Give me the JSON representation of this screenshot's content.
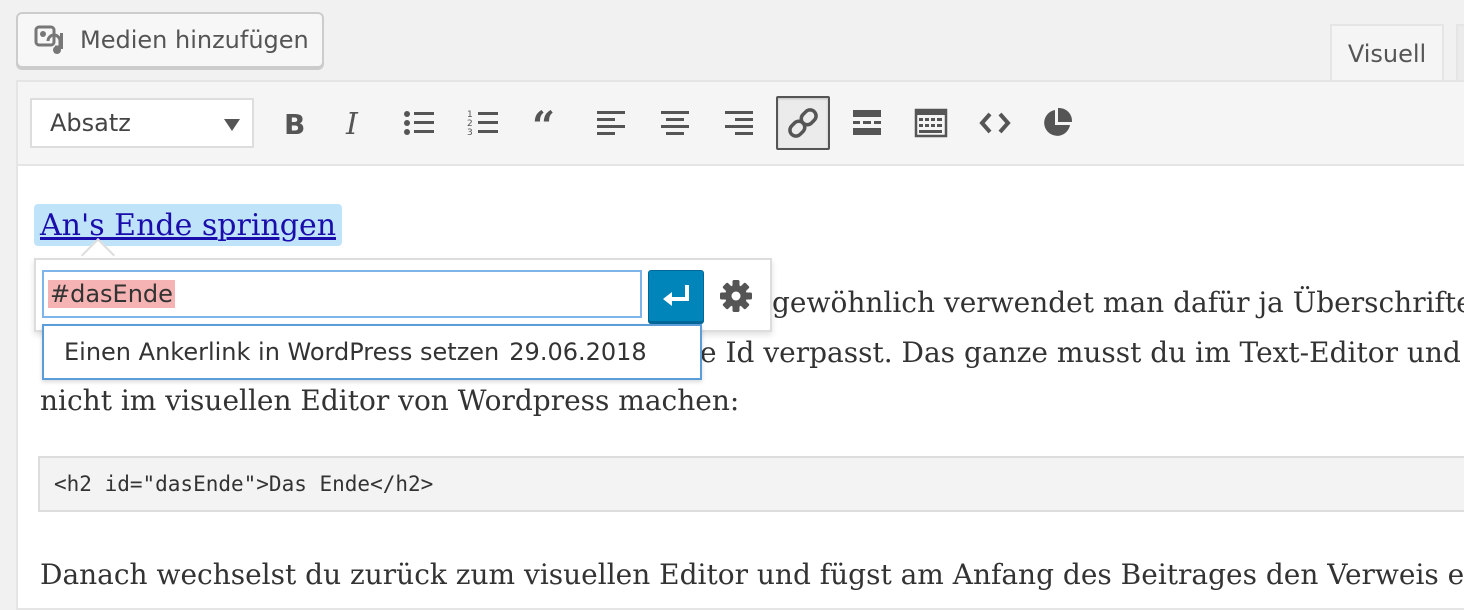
{
  "media_button": {
    "label": "Medien hinzufügen",
    "icon": "add-media-icon"
  },
  "tabs": {
    "visual": "Visuell"
  },
  "toolbar": {
    "format_select": "Absatz",
    "buttons": [
      "bold",
      "italic",
      "bullet-list",
      "numbered-list",
      "blockquote",
      "align-left",
      "align-center",
      "align-right",
      "insert-link",
      "read-more",
      "toolbar-toggle",
      "code",
      "chart"
    ],
    "active": "insert-link"
  },
  "content": {
    "anchor_text": "An's Ende springen",
    "para1_line1": "gewöhnlich verwendet man dafür ja Überschrifter",
    "para1_line2": "e Id verpasst. Das ganze musst du im Text-Editor und",
    "para1_line3": "nicht im visuellen Editor von Wordpress machen:",
    "code": "<h2 id=\"dasEnde\">Das Ende</h2>",
    "para2": "Danach wechselst du zurück zum visuellen Editor und fügst am Anfang des Beitrages den Verweis ein"
  },
  "link_popover": {
    "url_value": "#dasEnde",
    "suggestion_title": "Einen Ankerlink in WordPress setzen",
    "suggestion_date": "29.06.2018"
  },
  "colors": {
    "accent": "#0085ba",
    "link": "#1a0dab",
    "highlight": "#bfe3f9",
    "selection": "#f5b3b3"
  }
}
